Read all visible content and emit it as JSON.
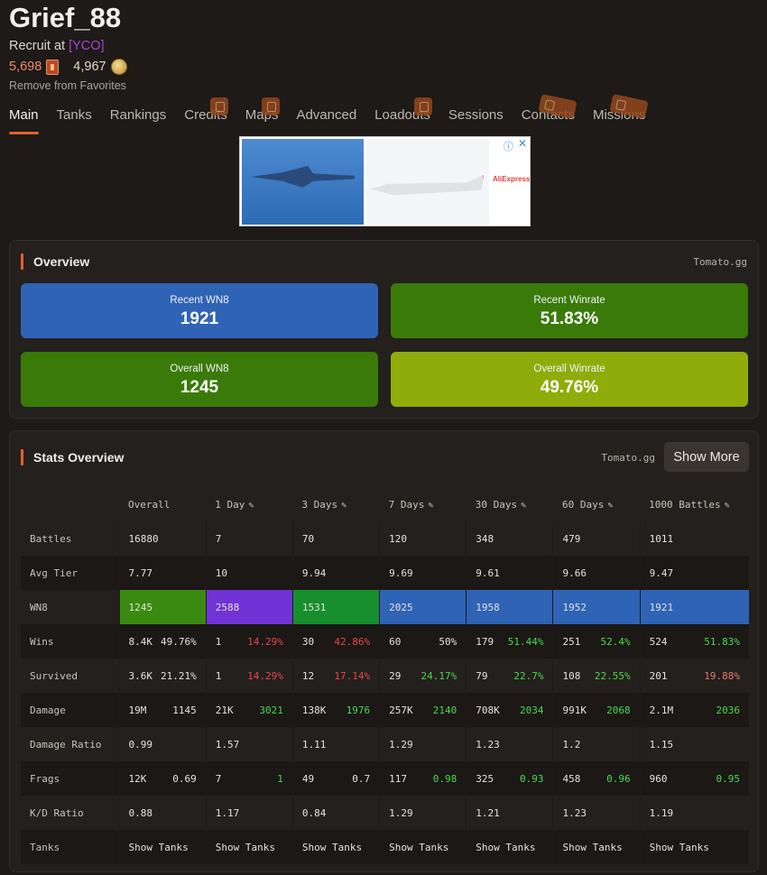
{
  "player": {
    "name": "Grief_88",
    "rank_prefix": "Recruit at ",
    "clan": "[YCO]",
    "gold": "5,698",
    "silver": "4,967",
    "remove_favorites": "Remove from Favorites"
  },
  "tabs": [
    "Main",
    "Tanks",
    "Rankings",
    "Credits",
    "Maps",
    "Advanced",
    "Loadouts",
    "Sessions",
    "Contacts",
    "Missions"
  ],
  "ad": {
    "brand": "AliExpress",
    "info_icon": "info-icon",
    "close_icon": "close-icon"
  },
  "overview": {
    "title": "Overview",
    "source": "Tomato.gg",
    "cards": [
      {
        "label": "Recent WN8",
        "value": "1921",
        "color": "#2f63b6"
      },
      {
        "label": "Recent Winrate",
        "value": "51.83%",
        "color": "#3a7a08"
      },
      {
        "label": "Overall WN8",
        "value": "1245",
        "color": "#3a7a08"
      },
      {
        "label": "Overall Winrate",
        "value": "49.76%",
        "color": "#8fac0a"
      }
    ]
  },
  "stats_overview": {
    "title": "Stats Overview",
    "source": "Tomato.gg",
    "show_more": "Show More",
    "columns": [
      "Overall",
      "1 Day",
      "3 Days",
      "7 Days",
      "30 Days",
      "60 Days",
      "1000 Battles"
    ],
    "rows": {
      "battles": {
        "label": "Battles",
        "values": [
          "16880",
          "7",
          "70",
          "120",
          "348",
          "479",
          "1011"
        ]
      },
      "avg_tier": {
        "label": "Avg Tier",
        "values": [
          "7.77",
          "10",
          "9.94",
          "9.69",
          "9.61",
          "9.66",
          "9.47"
        ]
      },
      "wn8": {
        "label": "WN8",
        "values": [
          "1245",
          "2588",
          "1531",
          "2025",
          "1958",
          "1952",
          "1921"
        ]
      },
      "wins": {
        "label": "Wins",
        "a": [
          "8.4K",
          "1",
          "30",
          "60",
          "179",
          "251",
          "524"
        ],
        "b": [
          "49.76%",
          "14.29%",
          "42.86%",
          "50%",
          "51.44%",
          "52.4%",
          "51.83%"
        ]
      },
      "survived": {
        "label": "Survived",
        "a": [
          "3.6K",
          "1",
          "12",
          "29",
          "79",
          "108",
          "201"
        ],
        "b": [
          "21.21%",
          "14.29%",
          "17.14%",
          "24.17%",
          "22.7%",
          "22.55%",
          "19.88%"
        ]
      },
      "damage": {
        "label": "Damage",
        "a": [
          "19M",
          "21K",
          "138K",
          "257K",
          "708K",
          "991K",
          "2.1M"
        ],
        "b": [
          "1145",
          "3021",
          "1976",
          "2140",
          "2034",
          "2068",
          "2036"
        ]
      },
      "damage_ratio": {
        "label": "Damage Ratio",
        "values": [
          "0.99",
          "1.57",
          "1.11",
          "1.29",
          "1.23",
          "1.2",
          "1.15"
        ]
      },
      "frags": {
        "label": "Frags",
        "a": [
          "12K",
          "7",
          "49",
          "117",
          "325",
          "458",
          "960"
        ],
        "b": [
          "0.69",
          "1",
          "0.7",
          "0.98",
          "0.93",
          "0.96",
          "0.95"
        ]
      },
      "kd_ratio": {
        "label": "K/D Ratio",
        "values": [
          "0.88",
          "1.17",
          "0.84",
          "1.29",
          "1.21",
          "1.23",
          "1.19"
        ]
      },
      "tanks": {
        "label": "Tanks",
        "values": [
          "Show Tanks",
          "Show Tanks",
          "Show Tanks",
          "Show Tanks",
          "Show Tanks",
          "Show Tanks",
          "Show Tanks"
        ]
      }
    },
    "colors": {
      "wn8_green": "#3a8a12",
      "wn8_purple": "#7133d5",
      "wn8_darkgreen": "#178f2f",
      "wn8_blue": "#2f63b6",
      "positive": "#49d94a",
      "negative": "#e54848"
    }
  }
}
